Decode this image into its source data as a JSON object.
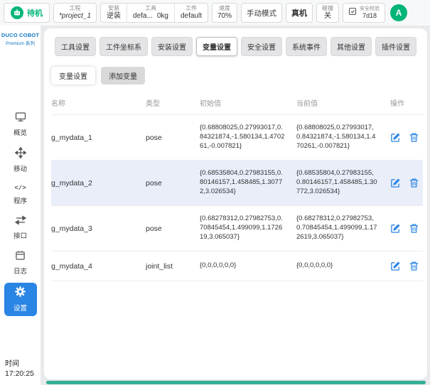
{
  "colors": {
    "accent_teal": "#00b578",
    "accent_blue": "#2b85e4"
  },
  "topbar": {
    "status_label": "待机",
    "project": {
      "label": "工程",
      "value": "*project_1"
    },
    "install": {
      "label": "安装",
      "value": "逆装"
    },
    "tool": {
      "label": "工具",
      "value": "defa...",
      "weight": "0kg"
    },
    "workpiece": {
      "label": "工件",
      "value": "default"
    },
    "speed": {
      "label": "速度",
      "value": "70%"
    },
    "manual_mode_label": "手动模式",
    "real_machine_label": "真机",
    "collision": {
      "label": "碰撞",
      "value": "关"
    },
    "safety": {
      "label": "安全校验",
      "value": "7d18"
    },
    "avatar_initial": "A"
  },
  "sidebar": {
    "logo_title": "DUCO COBOT",
    "logo_subtitle": "Premium 系列",
    "items": [
      {
        "label": "概览"
      },
      {
        "label": "移动"
      },
      {
        "label": "程序"
      },
      {
        "label": "接口"
      },
      {
        "label": "日志"
      },
      {
        "label": "设置"
      }
    ],
    "time_label": "时间",
    "time_value": "17:20:25"
  },
  "main": {
    "tabs": [
      {
        "label": "工具设置"
      },
      {
        "label": "工件坐标系"
      },
      {
        "label": "安装设置"
      },
      {
        "label": "变量设置"
      },
      {
        "label": "安全设置"
      },
      {
        "label": "系统事件"
      },
      {
        "label": "其他设置"
      },
      {
        "label": "插件设置"
      }
    ],
    "subtabs": [
      {
        "label": "变量设置"
      },
      {
        "label": "添加变量"
      }
    ],
    "table": {
      "headers": {
        "name": "名称",
        "type": "类型",
        "initial": "初始值",
        "current": "当前值",
        "actions": "操作"
      },
      "rows": [
        {
          "name": "g_mydata_1",
          "type": "pose",
          "initial": "{0.68808025,0.27993017,0.84321874,-1.580134,1.470261,-0.007821}",
          "current": "{0.68808025,0.27993017,0.84321874,-1.580134,1.470261,-0.007821}"
        },
        {
          "name": "g_mydata_2",
          "type": "pose",
          "initial": "{0.68535804,0.27983155,0.80146157,1.458485,1.30772,3.026534}",
          "current": "{0.68535804,0.27983155,0.80146157,1.458485,1.30772,3.026534}"
        },
        {
          "name": "g_mydata_3",
          "type": "pose",
          "initial": "{0.68278312,0.27982753,0.70845454,1.499099,1.172619,3.065037}",
          "current": "{0.68278312,0.27982753,0.70845454,1.499099,1.172619,3.065037}"
        },
        {
          "name": "g_mydata_4",
          "type": "joint_list",
          "initial": "{0,0,0,0,0,0}",
          "current": "{0,0,0,0,0,0}"
        }
      ]
    }
  }
}
